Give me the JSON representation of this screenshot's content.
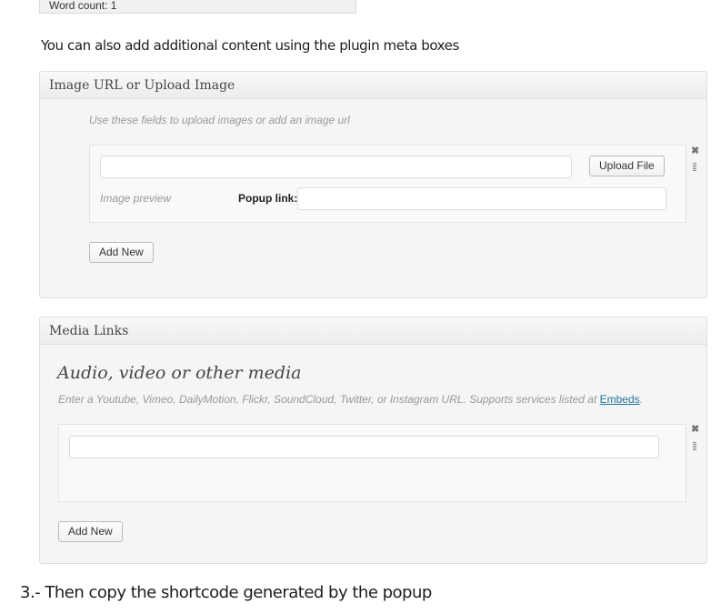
{
  "word_count": "Word count: 1",
  "intro_text": "You can also add additional content using the plugin meta boxes",
  "image_box": {
    "title": "Image URL or Upload Image",
    "hint": "Use these fields to upload images or add an image url",
    "url_value": "",
    "upload_button": "Upload File",
    "image_preview": "Image preview",
    "popup_label": "Popup link:",
    "popup_value": "",
    "add_new": "Add New",
    "remove_glyph": "✖"
  },
  "media_box": {
    "title": "Media Links",
    "heading": "Audio, video or other media",
    "hint_prefix": "Enter a Youtube, Vimeo, DailyMotion, Flickr, SoundCloud, Twitter, or Instagram URL. Supports services listed at",
    "embeds_link": "Embeds",
    "hint_suffix": ".",
    "url_value": "",
    "add_new": "Add New",
    "remove_glyph": "✖"
  },
  "step_text": "3.- Then copy the shortcode generated by the popup"
}
